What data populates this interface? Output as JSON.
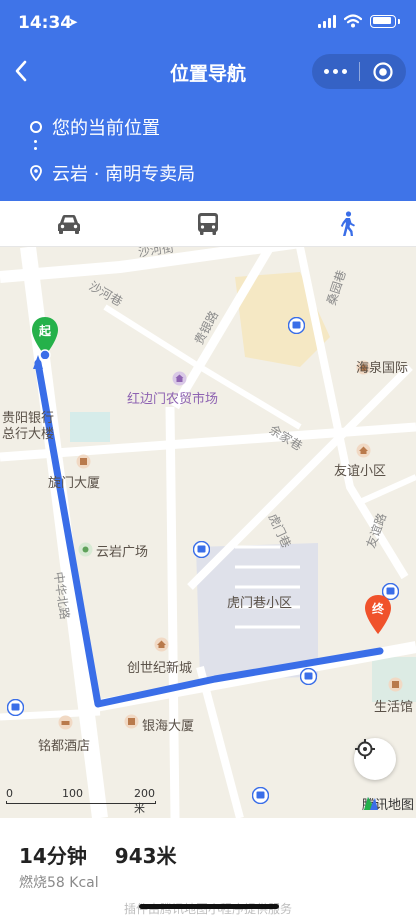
{
  "status": {
    "time": "14:34"
  },
  "nav": {
    "title": "位置导航"
  },
  "route": {
    "from": "您的当前位置",
    "to": "云岩 · 南明专卖局"
  },
  "modes": [
    {
      "name": "car",
      "active": false
    },
    {
      "name": "bus",
      "active": false
    },
    {
      "name": "walk",
      "active": true
    }
  ],
  "map": {
    "labels": {
      "shahe_jie": "沙河街",
      "shahe_xiang": "沙河巷",
      "sangyuan_xiang": "桑园巷",
      "guiyin_lu": "贵银路",
      "haiquan": "海泉国际",
      "hongbianmen": "红边门农贸市场",
      "guiyang_bank_1": "贵阳银行",
      "guiyang_bank_2": "总行大楼",
      "yujia_xiang": "余家巷",
      "youyi_xiaoqu": "友谊小区",
      "xuanmen": "旋门大厦",
      "youyi_lu": "友谊路",
      "humen_xiang": "虎门巷",
      "yunyan_plaza": "云岩广场",
      "zhonghua_beilu": "中华北路",
      "humen_xiaoqu": "虎门巷小区",
      "chuangshiji": "创世纪新城",
      "shenghuoguan": "生活馆",
      "yinhai": "银海大厦",
      "mingdu": "铭都酒店",
      "start_marker": "起",
      "end_marker": "终"
    },
    "scale": {
      "zero": "0",
      "mid": "100",
      "end": "200 米"
    },
    "provider": "腾讯地图"
  },
  "info": {
    "duration": "14分钟",
    "distance": "943米",
    "calories": "燃烧58 Kcal",
    "powered_by": "插件由腾讯地图小程序提供服务"
  },
  "colors": {
    "header": "#3f74e8",
    "route": "#3a6ee8",
    "active_mode": "#3a6ee8",
    "start": "#25b14a",
    "end": "#f0522b"
  }
}
